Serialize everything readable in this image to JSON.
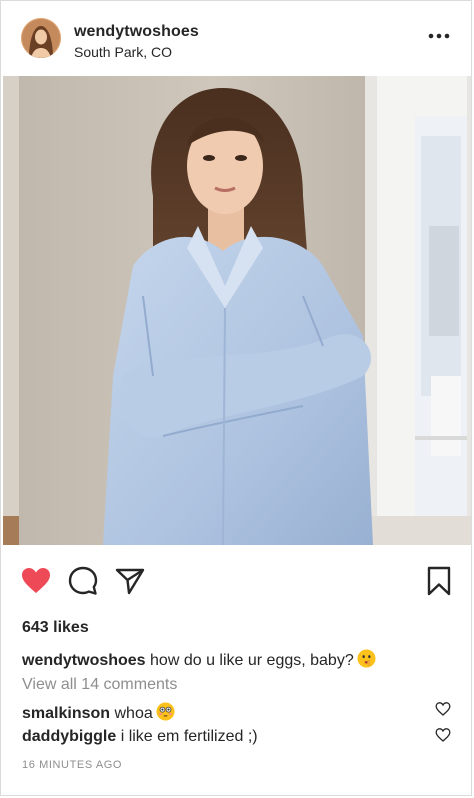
{
  "post": {
    "username": "wendytwoshoes",
    "location": "South Park, CO",
    "likes": "643 likes",
    "caption": {
      "username": "wendytwoshoes",
      "text": "how do u like ur eggs, baby?"
    },
    "view_all_comments": "View all 14 comments",
    "comments": [
      {
        "username": "smalkinson",
        "text": "whoa"
      },
      {
        "username": "daddybiggle",
        "text": "i like em fertilized ;)"
      }
    ],
    "timestamp": "16 MINUTES AGO",
    "liked": true
  },
  "icons": {
    "more": "more-options-icon",
    "like": "heart-filled-icon",
    "comment": "comment-bubble-icon",
    "share": "paper-plane-icon",
    "save": "bookmark-icon",
    "comment_like": "heart-outline-icon"
  },
  "colors": {
    "like_red": "#ed4956",
    "text": "#262626",
    "muted": "#8e8e8e",
    "border": "#dbdbdb"
  }
}
